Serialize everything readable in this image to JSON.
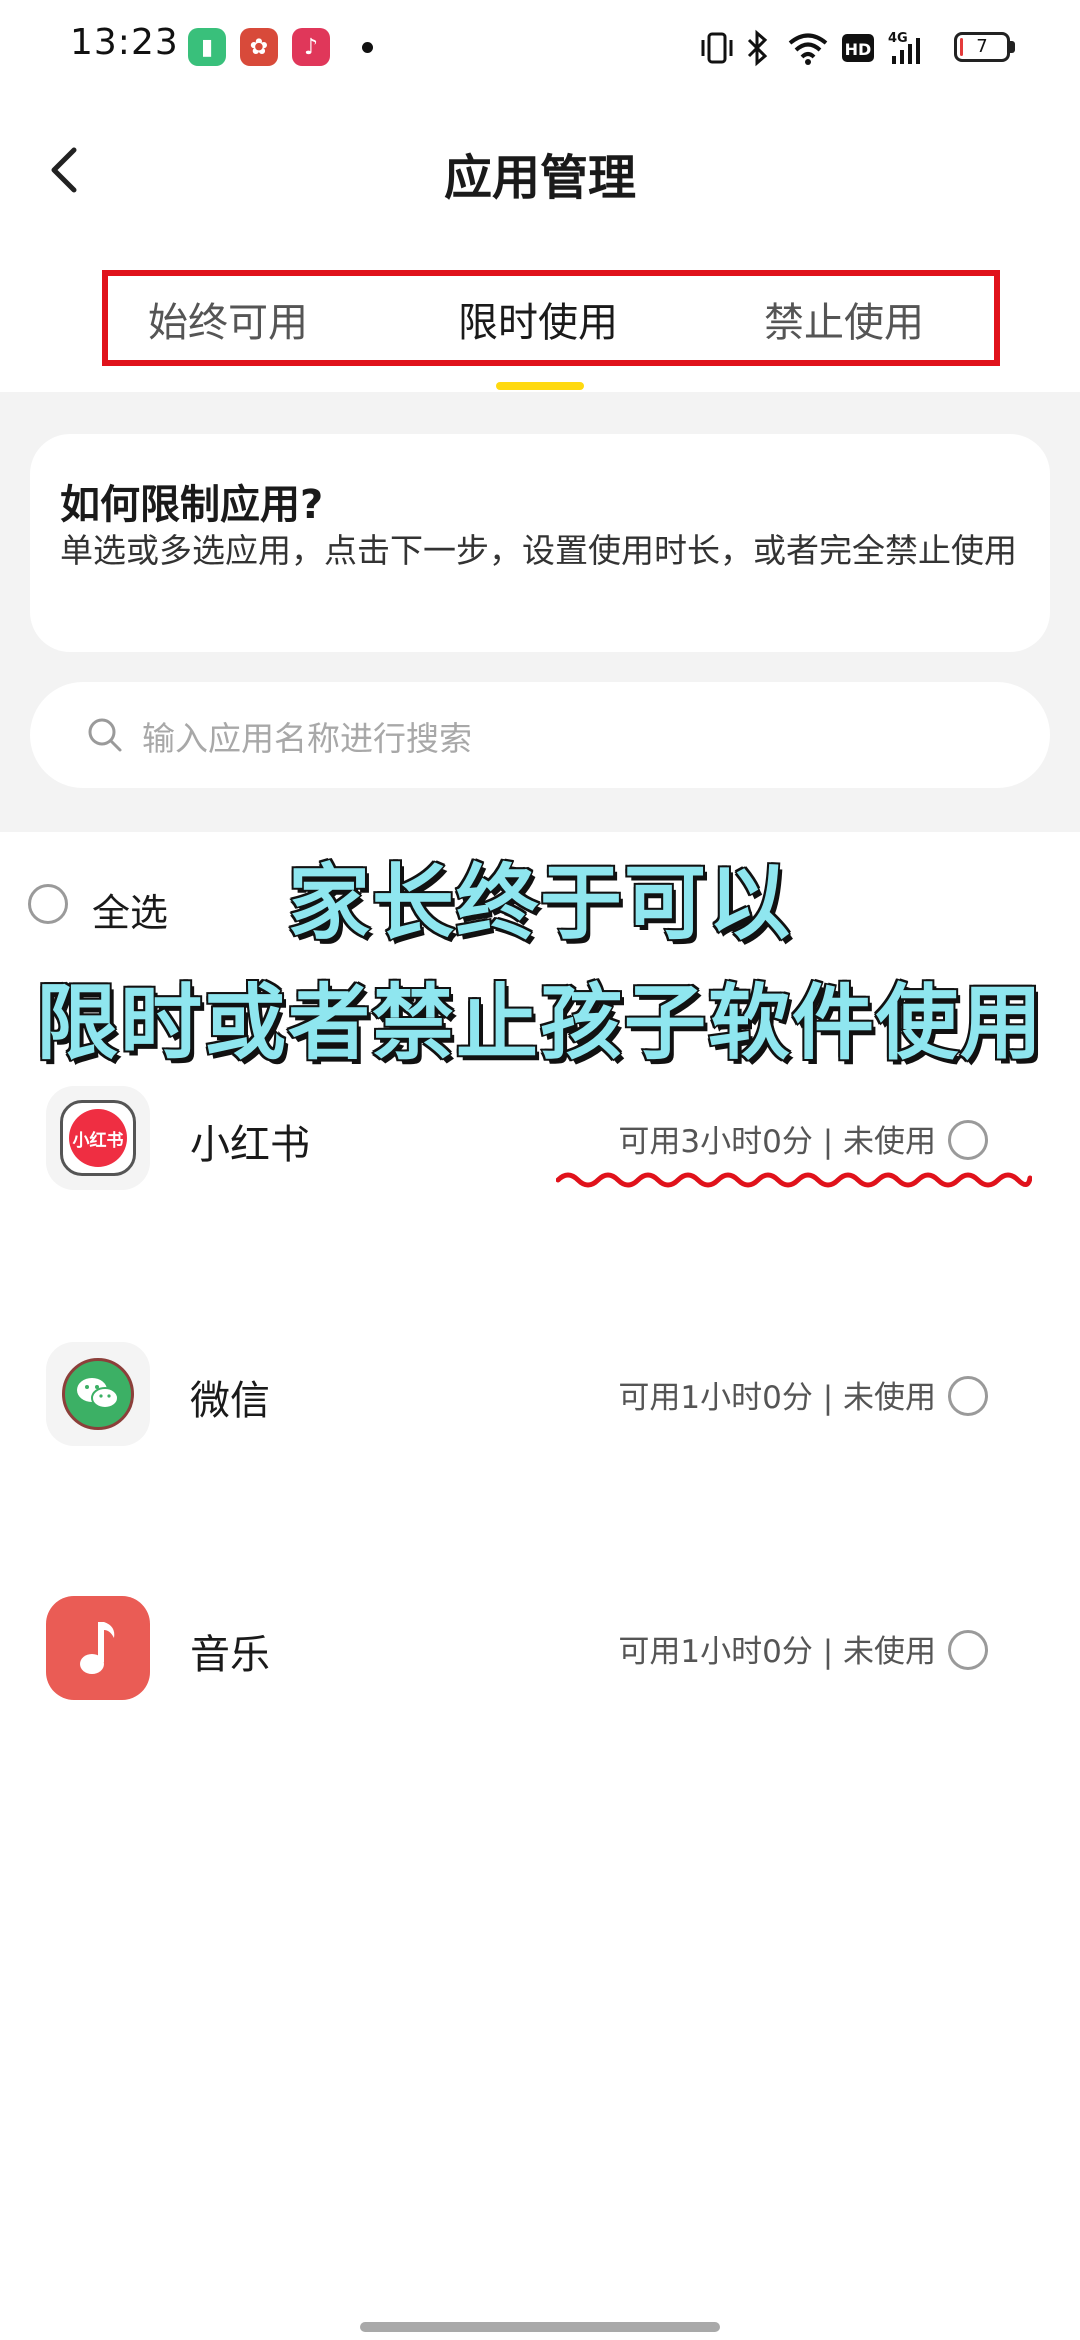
{
  "status_bar": {
    "time": "13:23",
    "battery_level": "7",
    "battery_fraction": 0.07,
    "icons": [
      "green-battery-app-icon",
      "red-app-icon",
      "music-app-icon",
      "notification-dot",
      "vibrate-icon",
      "bluetooth-icon",
      "wifi-icon",
      "hd-icon",
      "4g-signal-icon",
      "battery-icon"
    ]
  },
  "header": {
    "title": "应用管理"
  },
  "tabs": [
    {
      "label": "始终可用"
    },
    {
      "label": "限时使用",
      "active": true
    },
    {
      "label": "禁止使用"
    }
  ],
  "info_card": {
    "title": "如何限制应用?",
    "description": "单选或多选应用，点击下一步，设置使用时长，或者完全禁止使用"
  },
  "search": {
    "placeholder": "输入应用名称进行搜索"
  },
  "select_all": {
    "label": "全选"
  },
  "overlay": {
    "line1": "家长终于可以",
    "line2": "限时或者禁止孩子软件使用"
  },
  "apps": [
    {
      "name": "小红书",
      "status": "可用3小时0分 | 未使用",
      "icon_text": "小红书"
    },
    {
      "name": "微信",
      "status": "可用1小时0分 | 未使用"
    },
    {
      "name": "音乐",
      "status": "可用1小时0分 | 未使用"
    }
  ],
  "colors": {
    "tab_indicator": "#ffd90f",
    "highlight_frame": "#e0121b",
    "overlay_text": "#8fe6ef",
    "music_icon_bg": "#ea5c55",
    "wechat_green": "#3cb065",
    "xhs_red": "#ef2e42"
  }
}
